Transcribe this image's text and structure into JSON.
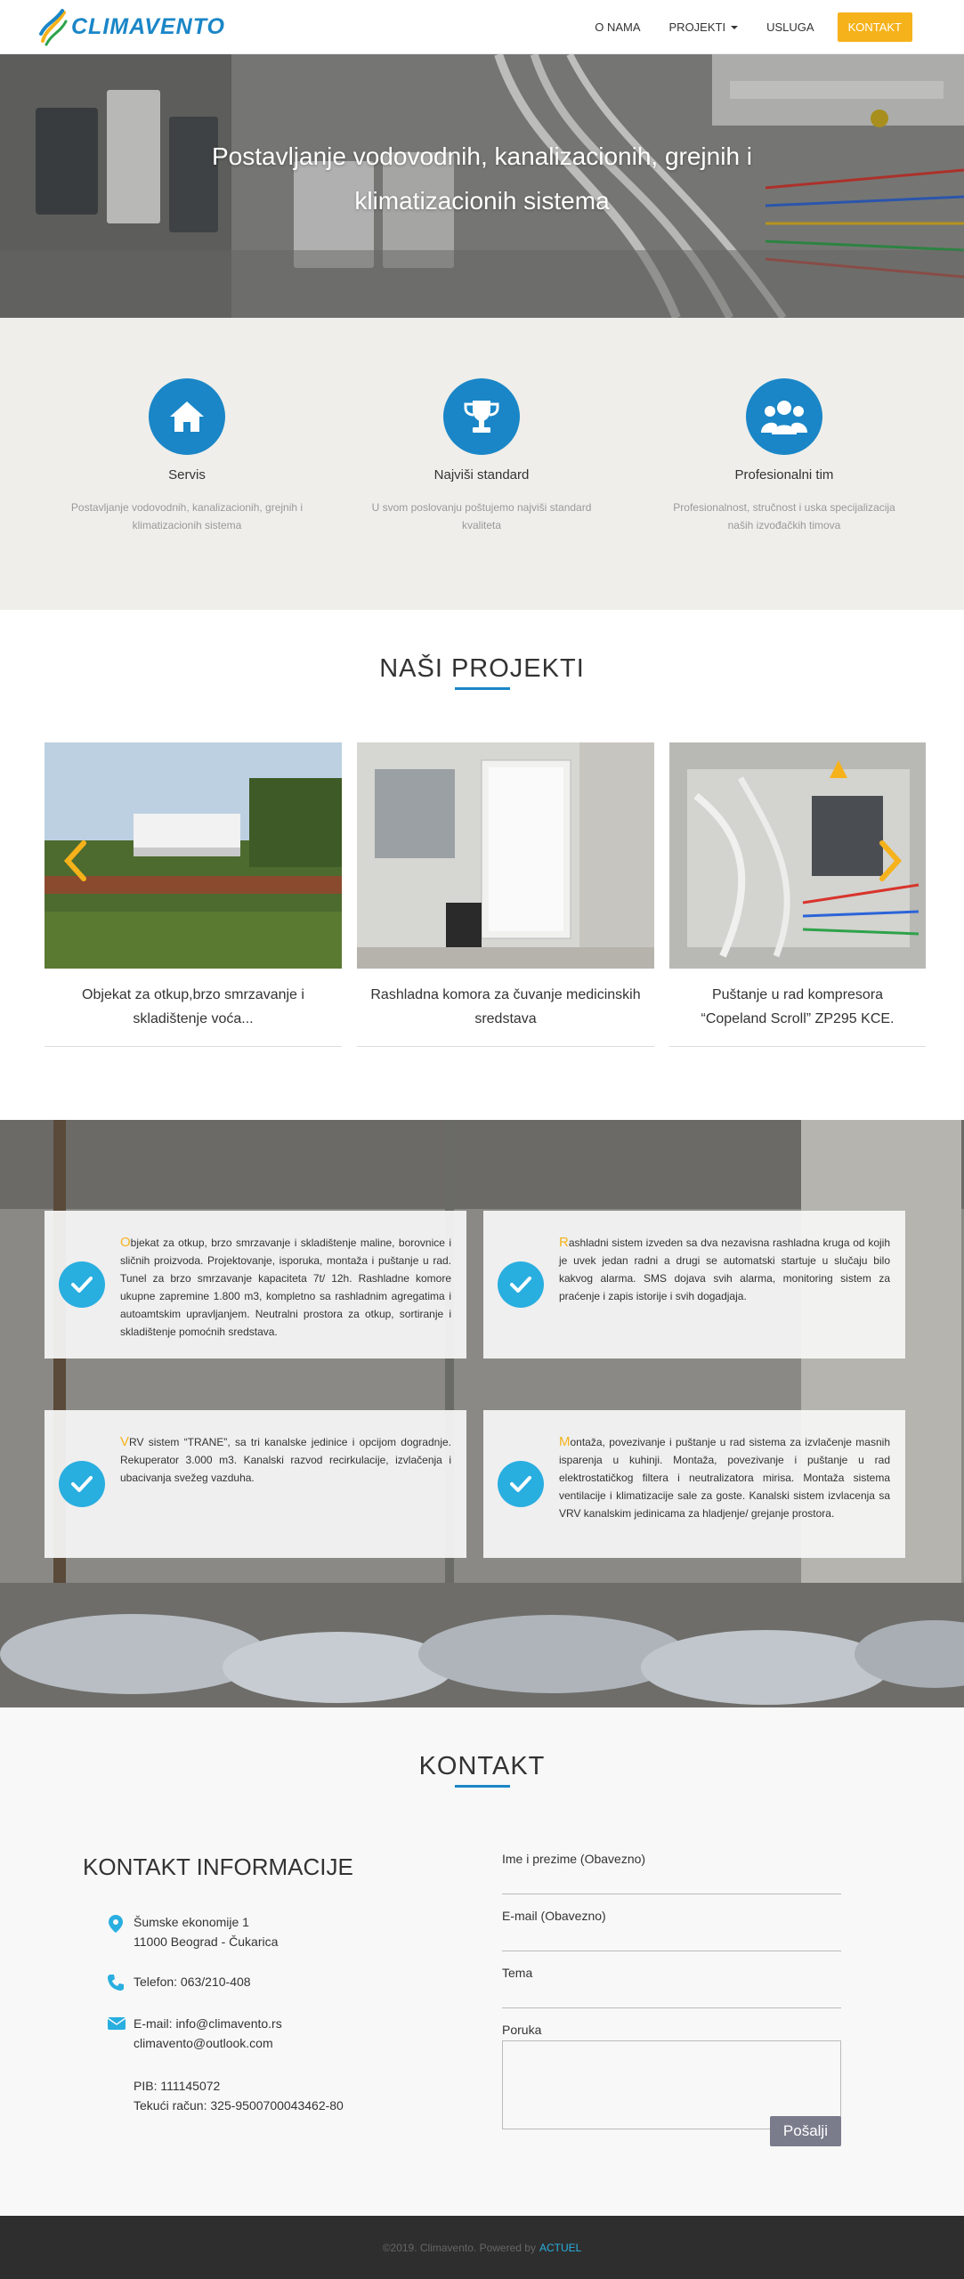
{
  "brand": {
    "name": "CLIMAVENTO"
  },
  "nav": {
    "items": [
      {
        "label": "O NAMA"
      },
      {
        "label": "PROJEKTI"
      },
      {
        "label": "USLUGA"
      }
    ],
    "cta": "KONTAKT"
  },
  "hero": {
    "title": "Postavljanje vodovodnih, kanalizacionih, grejnih i klimatizacionih sistema"
  },
  "features": [
    {
      "icon": "house-icon",
      "title": "Servis",
      "text": "Postavljanje vodovodnih, kanalizacionih, grejnih i klimatizacionih sistema"
    },
    {
      "icon": "trophy-icon",
      "title": "Najviši standard",
      "text": "U svom poslovanju poštujemo najviši standard kvaliteta"
    },
    {
      "icon": "team-icon",
      "title": "Profesionalni tim",
      "text": "Profesionalnost, stručnost i uska specijalizacija naših izvođačkih timova"
    }
  ],
  "projects": {
    "title_part1": "NAŠI ",
    "title_part2": "PROJEKTI",
    "items": [
      {
        "caption": "Objekat za otkup,brzo smrzavanje i skladištenje voća..."
      },
      {
        "caption": "Rashladna komora za čuvanje medicinskih sredstava"
      },
      {
        "caption": "Puštanje u rad kompresora “Copeland Scroll” ZP295 KCE."
      }
    ],
    "prev": "‹",
    "next": "›"
  },
  "references": [
    {
      "cap": "O",
      "text": "bjekat za otkup, brzo smrzavanje i skladištenje maline, borovnice i sličnih proizvoda. Projektovanje, isporuka, montaža i puštanje u rad. Tunel za brzo smrzavanje kapaciteta 7t/ 12h. Rashladne komore ukupne zapremine 1.800 m3, kompletno sa rashladnim agregatima i autoamtskim upravljanjem. Neutralni prostora za otkup, sortiranje i skladištenje pomoćnih sredstava."
    },
    {
      "cap": "R",
      "text": "ashladni sistem izveden sa dva nezavisna rashladna kruga od kojih je uvek jedan radni a drugi se automatski startuje u slučaju bilo kakvog alarma. SMS dojava svih alarma, monitoring sistem za praćenje i zapis istorije i svih dogadjaja."
    },
    {
      "cap": "V",
      "text": "RV sistem “TRANE”, sa tri kanalske jedinice i opcijom dogradnje. Rekuperator 3.000 m3. Kanalski razvod recirkulacije, izvlačenja i ubacivanja svežeg vazduha."
    },
    {
      "cap": "M",
      "text": "ontaža, povezivanje i puštanje u rad sistema za izvlačenje masnih isparenja u kuhinji. Montaža, povezivanje i puštanje u rad elektrostatičkog filtera i neutralizatora mirisa. Montaža sistema ventilacije i klimatizacije sale za goste. Kanalski sistem izvlacenja sa VRV kanalskim jedinicama za hladjenje/ grejanje prostora."
    }
  ],
  "contact": {
    "title": "KONTAKT",
    "info_title": "KONTAKT INFORMACIJE",
    "address_line1": "Šumske ekonomije 1",
    "address_line2": "11000 Beograd - Čukarica",
    "phone": "Telefon: 063/210-408",
    "email_line1": "E-mail: info@climavento.rs",
    "email_line2": "climavento@outlook.com",
    "pib": "PIB: 111145072",
    "account": "Tekući račun: 325-9500700043462-80",
    "form": {
      "name_label": "Ime i prezime (Obavezno)",
      "email_label": "E-mail (Obavezno)",
      "subject_label": "Tema",
      "message_label": "Poruka",
      "submit": "Pošalji"
    }
  },
  "footer": {
    "text": "©2019. Climavento. Powered by",
    "link": "ACTUEL"
  },
  "colors": {
    "primary": "#1a86c7",
    "accent": "#f6b21a",
    "check": "#29aee0"
  }
}
